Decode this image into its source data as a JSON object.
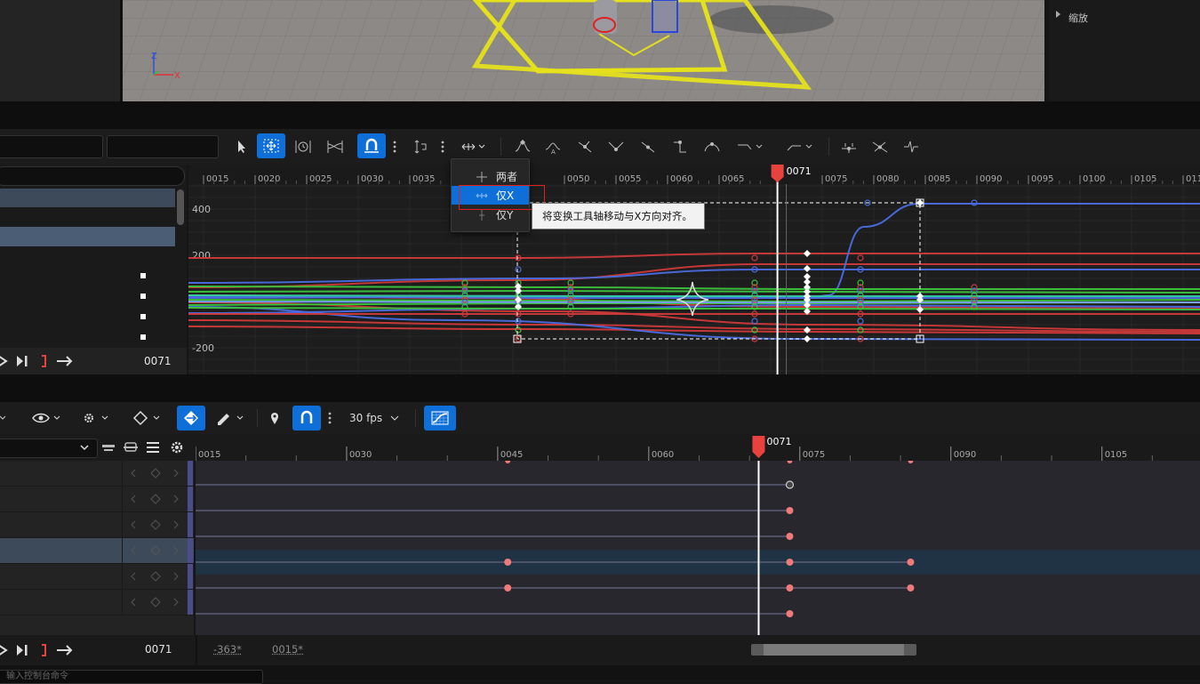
{
  "details": {
    "zoom_label": "缩放"
  },
  "viewport": {
    "axis_z": "Z",
    "axis_y": "Y",
    "axis_x": "X"
  },
  "curve_editor": {
    "playhead_frame": "0071",
    "ruler_ticks": [
      "0015",
      "0020",
      "0025",
      "0030",
      "0035",
      "0050",
      "0055",
      "0060",
      "0065",
      "0075",
      "0080",
      "0085",
      "0090",
      "0095",
      "0100",
      "0105",
      "0110"
    ],
    "y_labels": [
      "400",
      "200",
      "-200"
    ],
    "current_frame": "0071"
  },
  "axis_popup": {
    "items": [
      {
        "label": "两者"
      },
      {
        "label": "仅X"
      },
      {
        "label": "仅Y"
      }
    ],
    "tooltip": "将变换工具轴移动与X方向对齐。"
  },
  "sequencer": {
    "fps_label": "30 fps",
    "playhead_frame": "0071",
    "ruler_ticks": [
      "0015",
      "0030",
      "0045",
      "0060",
      "0075",
      "0090",
      "0105"
    ],
    "current_frame": "0071",
    "range_start": "-363*",
    "range_end": "0015*",
    "console_placeholder": "输入控制台命令"
  },
  "colors": {
    "accent": "#0f6fd9",
    "playhead": "#e8423f",
    "key": "#f07a7a"
  },
  "icons": [
    "select-arrow-icon",
    "transform-tool-icon",
    "retime-tool-icon",
    "multi-curve-icon",
    "snap-magnet-icon",
    "more-vert-icon",
    "snap-vertical-icon",
    "axis-both-icon",
    "chevron-down-icon",
    "key-auto-icon",
    "key-user-icon",
    "key-break-icon",
    "key-linear-icon",
    "key-constant-icon",
    "key-cubic-icon",
    "flatten-tangent-icon",
    "straighten-tangent-icon",
    "filter-icon",
    "eye-icon",
    "gear-icon",
    "location-pin-icon"
  ]
}
